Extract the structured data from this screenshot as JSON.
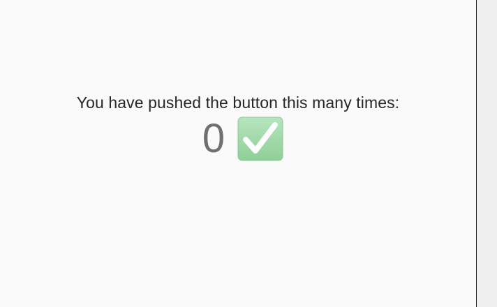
{
  "main": {
    "message": "You have pushed the button this many times:",
    "counter": "0",
    "status_icon": "green-checkmark-icon"
  },
  "colors": {
    "background": "#fafafa",
    "side_panel": "#efefef",
    "check_green": "#9fd8a6"
  }
}
